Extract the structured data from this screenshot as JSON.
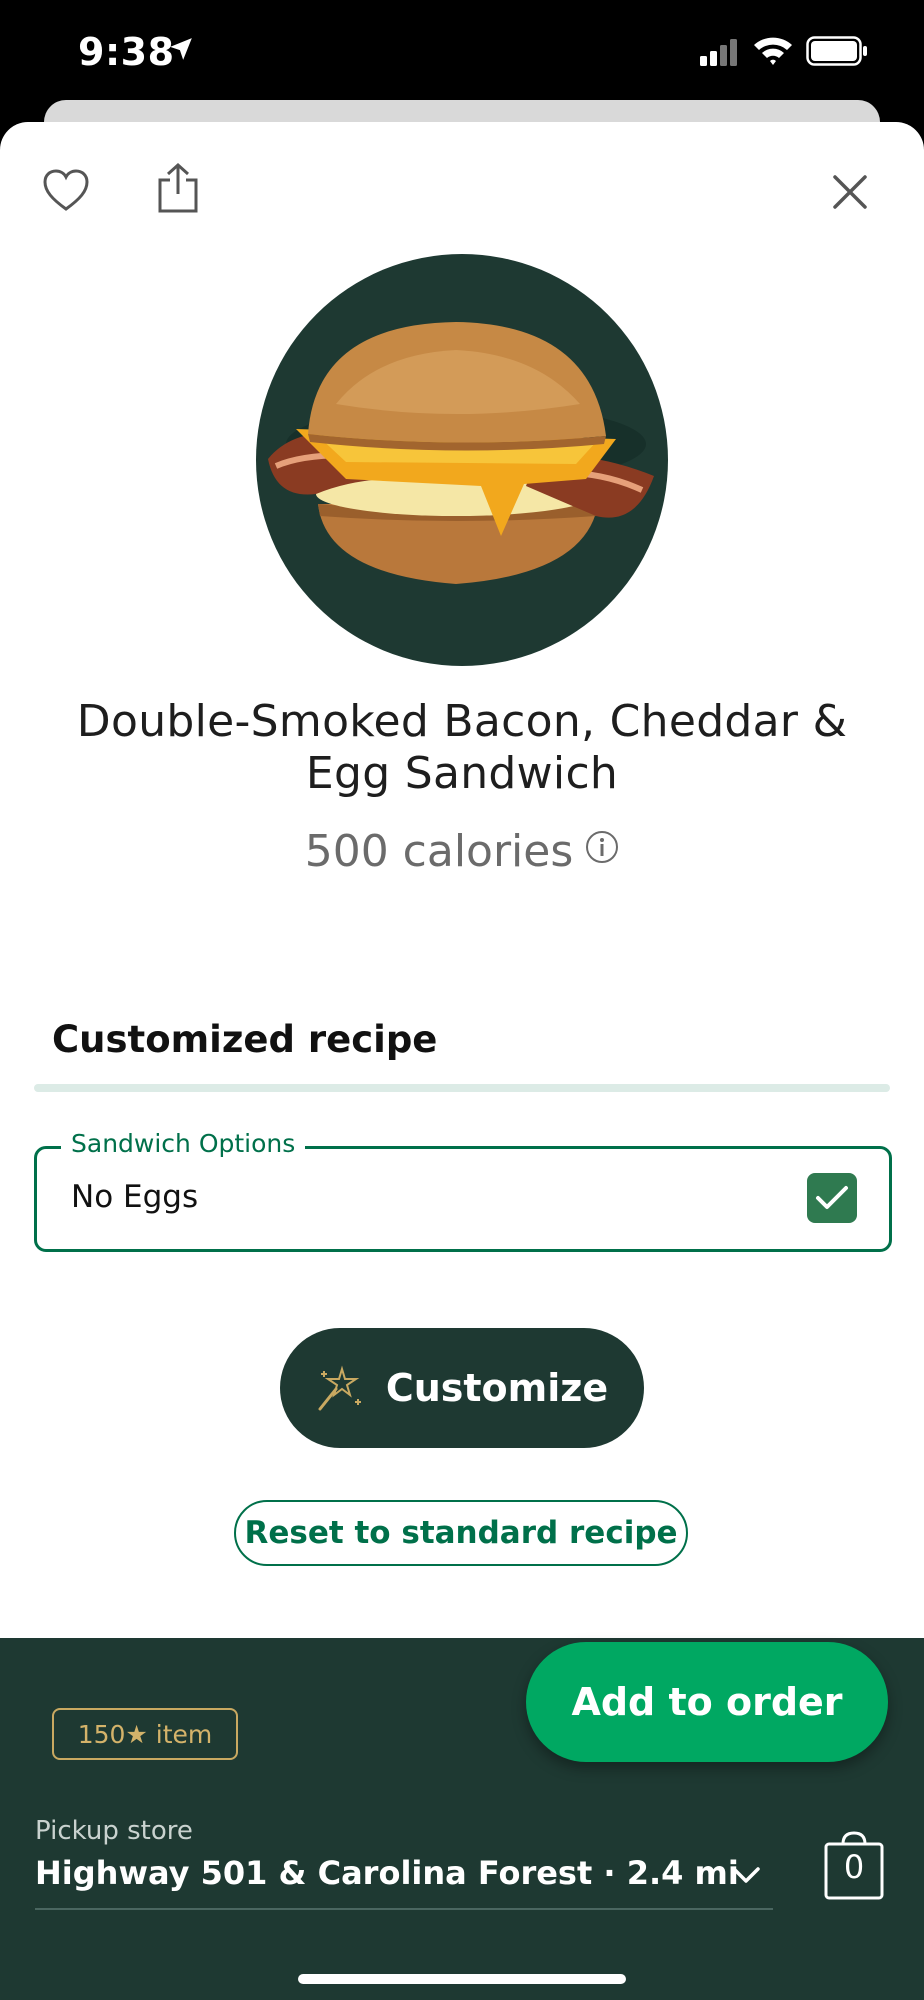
{
  "status": {
    "time": "9:38"
  },
  "product": {
    "name": "Double-Smoked Bacon, Cheddar & Egg Sandwich",
    "calories": "500 calories"
  },
  "recipe": {
    "heading": "Customized recipe",
    "option_group": "Sandwich Options",
    "option_value": "No Eggs",
    "option_checked": true
  },
  "actions": {
    "customize": "Customize",
    "reset": "Reset to standard recipe",
    "add": "Add to order"
  },
  "footer": {
    "stars_badge": "150★ item",
    "pickup_label": "Pickup store",
    "pickup_store": "Highway 501 & Carolina Forest · 2.4 mi",
    "bag_count": "0"
  },
  "colors": {
    "brand_dark": "#1e3932",
    "brand_green": "#00704a",
    "accent_green": "#00a862",
    "gold": "#c9a961"
  }
}
